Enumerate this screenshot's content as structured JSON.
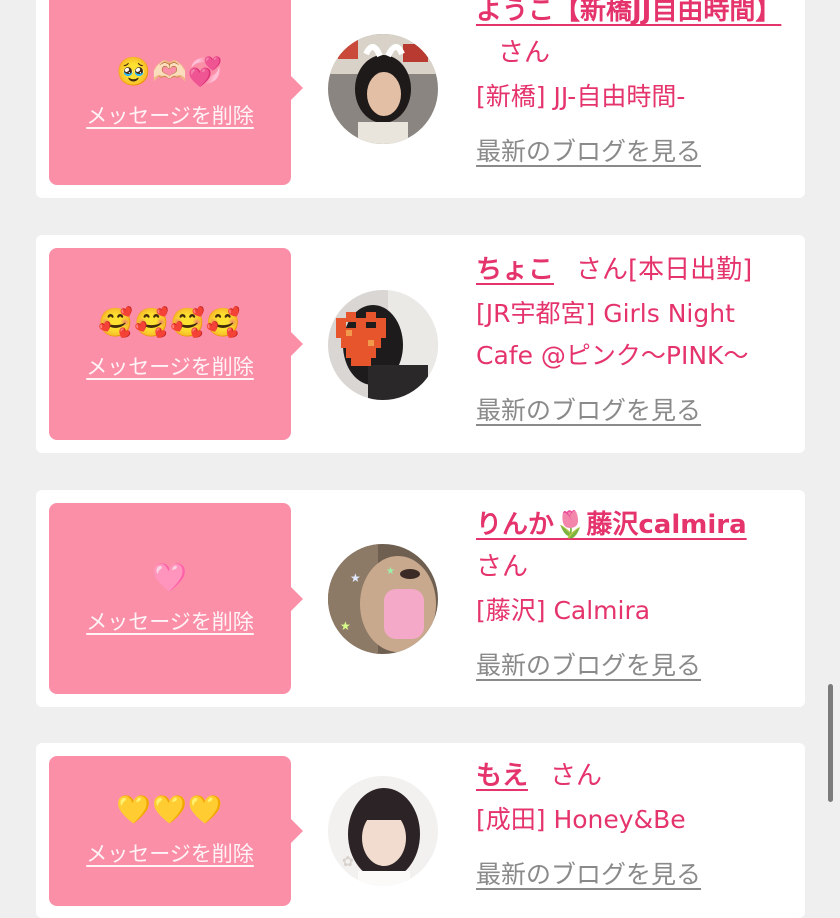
{
  "cards": [
    {
      "emoji": "🥹🫶🏻💞",
      "delete_label": "メッセージを削除",
      "name": "ようこ【新橋JJ自由時間】",
      "san": "さん",
      "shop": "[新橋] JJ-自由時間-",
      "blog_label": "最新のブログを見る"
    },
    {
      "emoji": "🥰🥰🥰🥰",
      "delete_label": "メッセージを削除",
      "name": "ちょこ",
      "san": "さん[本日出勤]",
      "shop": "[JR宇都宮] Girls Night Cafe @ピンク〜PINK〜",
      "blog_label": "最新のブログを見る"
    },
    {
      "emoji": "🩷",
      "delete_label": "メッセージを削除",
      "name": "りんか🌷藤沢calmira",
      "san": "さん",
      "shop": "[藤沢] Calmira",
      "blog_label": "最新のブログを見る"
    },
    {
      "emoji": "💛💛💛",
      "delete_label": "メッセージを削除",
      "name": "もえ",
      "san": "さん",
      "shop": "[成田] Honey&Be",
      "blog_label": "最新のブログを見る"
    }
  ],
  "colors": {
    "accent": "#e5336c",
    "bubble": "#fb8fa8",
    "background": "#efeff0",
    "link_gray": "#8a8a8a"
  }
}
